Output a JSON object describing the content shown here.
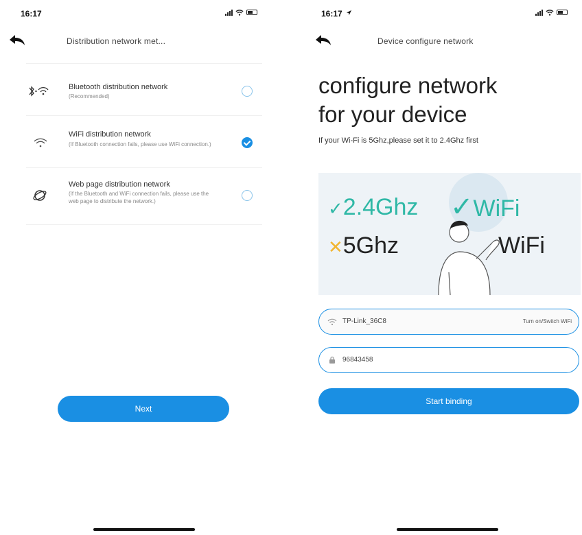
{
  "left": {
    "status": {
      "time": "16:17"
    },
    "nav": {
      "title": "Distribution network met..."
    },
    "methods": [
      {
        "title": "Bluetooth distribution network",
        "desc": "(Recommended)",
        "icon": "bluetooth-wifi-icon",
        "selected": false
      },
      {
        "title": "WiFi distribution network",
        "desc": "(If Bluetooth connection fails, please use WiFi connection.)",
        "icon": "wifi-icon",
        "selected": true
      },
      {
        "title": "Web page distribution network",
        "desc": "(If the Bluetooth and WiFi connection fails, please use the web page to distribute the network.)",
        "icon": "globe-icon",
        "selected": false
      }
    ],
    "next_label": "Next"
  },
  "right": {
    "status": {
      "time": "16:17"
    },
    "nav": {
      "title": "Device configure network"
    },
    "hero": {
      "line1": "configure network",
      "line2": "for your device",
      "subtitle": "If your Wi-Fi is 5Ghz,please set it to 2.4Ghz first"
    },
    "illustration": {
      "good_band": "2.4Ghz",
      "good_label": "WiFi",
      "bad_band": "5Ghz",
      "bad_label": "WiFi",
      "good_color": "#2fb8a6",
      "bad_color": "#f2b632"
    },
    "wifi_field": {
      "value": "TP-Link_36C8",
      "action": "Turn on/Switch WiFi"
    },
    "password_field": {
      "value": "96843458"
    },
    "start_label": "Start binding"
  },
  "colors": {
    "accent": "#1a8fe3",
    "illustration_bg": "#eef3f7"
  }
}
